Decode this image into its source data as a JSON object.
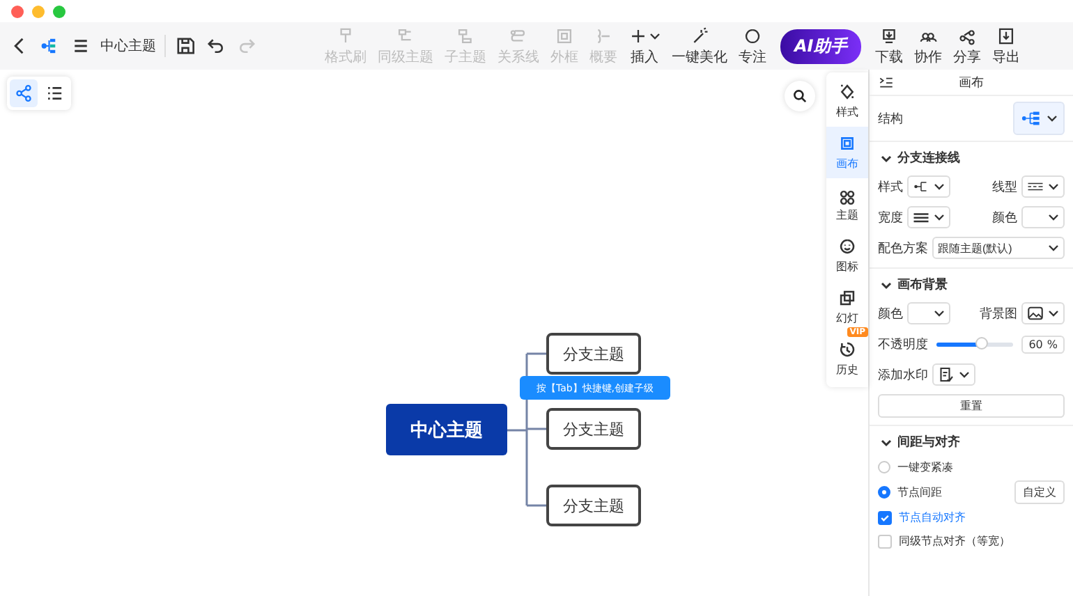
{
  "toolbar": {
    "document_title": "中心主题",
    "redo_disabled": true,
    "tools": [
      {
        "label": "格式刷",
        "disabled": true,
        "kind": "tool"
      },
      {
        "label": "同级主题",
        "disabled": true,
        "kind": "tool"
      },
      {
        "label": "子主题",
        "disabled": true,
        "kind": "tool"
      },
      {
        "label": "关系线",
        "disabled": true,
        "kind": "tool"
      },
      {
        "label": "外框",
        "disabled": true,
        "kind": "tool"
      },
      {
        "label": "概要",
        "disabled": true,
        "kind": "tool"
      },
      {
        "label": "插入",
        "disabled": false,
        "kind": "dropdown"
      },
      {
        "label": "一键美化",
        "disabled": false,
        "kind": "tool"
      },
      {
        "label": "专注",
        "disabled": false,
        "kind": "tool"
      },
      {
        "label": "AI助手",
        "disabled": false,
        "kind": "ai"
      },
      {
        "label": "下载",
        "disabled": false,
        "kind": "tool"
      },
      {
        "label": "协作",
        "disabled": false,
        "kind": "tool"
      },
      {
        "label": "分享",
        "disabled": false,
        "kind": "tool"
      },
      {
        "label": "导出",
        "disabled": false,
        "kind": "tool"
      }
    ]
  },
  "view_switch": [
    {
      "selected": true
    },
    {
      "selected": false
    }
  ],
  "mind_map": {
    "center": "中心主题",
    "branches": [
      "分支主题",
      "分支主题",
      "分支主题"
    ],
    "tooltip": "按【Tab】快捷键,创建子级"
  },
  "side_rail": [
    {
      "label": "样式",
      "selected": false
    },
    {
      "label": "画布",
      "selected": true
    },
    {
      "label": "主题",
      "selected": false
    },
    {
      "label": "图标",
      "selected": false
    },
    {
      "label": "幻灯",
      "selected": false
    },
    {
      "label": "历史",
      "selected": false,
      "badge": "VIP"
    }
  ],
  "panel": {
    "title": "画布",
    "structure_label": "结构",
    "branch_lines": {
      "title": "分支连接线",
      "expanded": true,
      "style_label": "样式",
      "line_type_label": "线型",
      "width_label": "宽度",
      "color_label": "颜色",
      "scheme_label": "配色方案",
      "scheme_value": "跟随主题(默认)"
    },
    "background": {
      "title": "画布背景",
      "expanded": true,
      "color_label": "颜色",
      "image_label": "背景图",
      "opacity_label": "不透明度",
      "opacity": {
        "level": 0.6,
        "reading": "60",
        "unit": "%"
      },
      "watermark_label": "添加水印",
      "reset_button": "重置"
    },
    "spacing": {
      "title": "间距与对齐",
      "expanded": true,
      "radios": [
        {
          "label": "一键变紧凑",
          "selected": false
        },
        {
          "label": "节点间距",
          "selected": true
        }
      ],
      "custom_button": "自定义",
      "checkboxes": [
        {
          "label": "节点自动对齐",
          "checked": true
        },
        {
          "label": "同级节点对齐（等宽）",
          "checked": false
        }
      ]
    }
  }
}
